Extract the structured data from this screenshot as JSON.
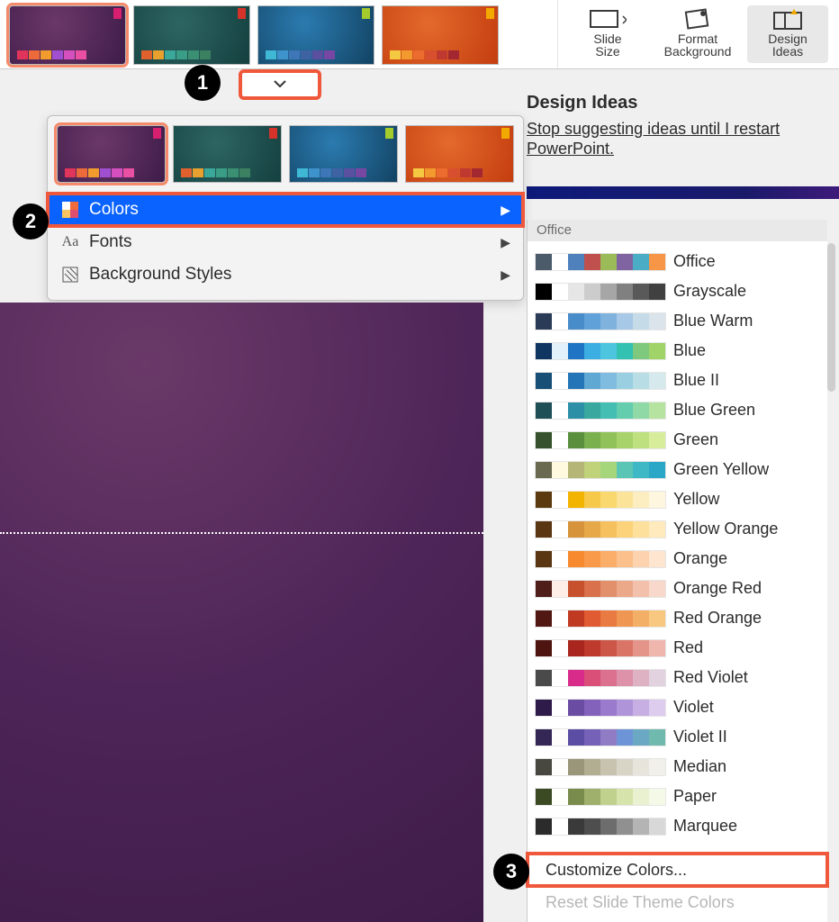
{
  "ribbon": {
    "slide_size": "Slide\nSize",
    "format_bg": "Format\nBackground",
    "design_ideas": "Design\nIdeas"
  },
  "pane": {
    "title": "Design Ideas",
    "link": "Stop suggesting ideas until I restart PowerPoint."
  },
  "menu": {
    "colors": "Colors",
    "fonts": "Fonts",
    "bg_styles": "Background Styles"
  },
  "schemes_header": "Office",
  "schemes": [
    {
      "name": "Office",
      "c": [
        "#4b5b69",
        "#ffffff",
        "#4f81bd",
        "#c0504d",
        "#9bbb59",
        "#8064a2",
        "#4bacc6",
        "#f79646"
      ]
    },
    {
      "name": "Grayscale",
      "c": [
        "#000000",
        "#ffffff",
        "#e6e6e6",
        "#cccccc",
        "#a6a6a6",
        "#808080",
        "#595959",
        "#404040"
      ]
    },
    {
      "name": "Blue Warm",
      "c": [
        "#2a3b57",
        "#ffffff",
        "#488cc9",
        "#5fa1d8",
        "#7fb3de",
        "#a7c8e6",
        "#c6dbe8",
        "#dbe4ea"
      ]
    },
    {
      "name": "Blue",
      "c": [
        "#0f3561",
        "#e3f1fb",
        "#1f75c4",
        "#3daee1",
        "#4ec5df",
        "#33c1b1",
        "#7fc97f",
        "#a0d468"
      ]
    },
    {
      "name": "Blue II",
      "c": [
        "#184f76",
        "#ffffff",
        "#2375b7",
        "#5fa8d3",
        "#7fbce0",
        "#99cfe1",
        "#b9dde5",
        "#d6e9ec"
      ]
    },
    {
      "name": "Blue Green",
      "c": [
        "#1e4f56",
        "#ffffff",
        "#2c8fa6",
        "#3ba8a0",
        "#44beb3",
        "#63cdae",
        "#8fd9a7",
        "#b7e3a0"
      ]
    },
    {
      "name": "Green",
      "c": [
        "#37512e",
        "#ffffff",
        "#5a8f3e",
        "#7bb04f",
        "#91c25a",
        "#a8d26a",
        "#bfe07e",
        "#d8ed9c"
      ]
    },
    {
      "name": "Green Yellow",
      "c": [
        "#6a6a50",
        "#fffadf",
        "#b5b578",
        "#c0d27a",
        "#a6d67c",
        "#5bc5b5",
        "#3eb8c4",
        "#2aa6c6"
      ]
    },
    {
      "name": "Yellow",
      "c": [
        "#5a3a0e",
        "#ffffff",
        "#f2b400",
        "#f6c94a",
        "#f9d86f",
        "#fbe49a",
        "#fceec1",
        "#fef6df"
      ]
    },
    {
      "name": "Yellow Orange",
      "c": [
        "#5a3612",
        "#ffffff",
        "#d7933b",
        "#e7a84a",
        "#f5c15e",
        "#fcd37a",
        "#fde09c",
        "#feeabd"
      ]
    },
    {
      "name": "Orange",
      "c": [
        "#5a3612",
        "#ffffff",
        "#f78a2f",
        "#f99a4a",
        "#fbae6a",
        "#fcc08c",
        "#fdd3af",
        "#fee5d0"
      ]
    },
    {
      "name": "Orange Red",
      "c": [
        "#4f1e19",
        "#fdeee7",
        "#c7502d",
        "#d9714c",
        "#e2906c",
        "#eca98a",
        "#f2c0ab",
        "#f7d8cb"
      ]
    },
    {
      "name": "Red Orange",
      "c": [
        "#501713",
        "#ffffff",
        "#c03a22",
        "#e05a32",
        "#e97a41",
        "#ef9652",
        "#f4af66",
        "#f8c881"
      ]
    },
    {
      "name": "Red",
      "c": [
        "#4e1410",
        "#ffffff",
        "#a8261e",
        "#be3a2d",
        "#cc5648",
        "#d97467",
        "#e49488",
        "#efb6ad"
      ]
    },
    {
      "name": "Red Violet",
      "c": [
        "#4a4a4a",
        "#ffffff",
        "#d92c8a",
        "#d94f78",
        "#db718f",
        "#dd92a9",
        "#dfb2c3",
        "#e2d1de"
      ]
    },
    {
      "name": "Violet",
      "c": [
        "#2e1b4a",
        "#ffffff",
        "#6a4da3",
        "#8262bb",
        "#9a7acd",
        "#b094da",
        "#c7afe4",
        "#ddccee"
      ]
    },
    {
      "name": "Violet II",
      "c": [
        "#342755",
        "#fffdfb",
        "#5a4da3",
        "#7561b7",
        "#8f7cc4",
        "#6c94d6",
        "#6ba8c3",
        "#6fb9ae"
      ]
    },
    {
      "name": "Median",
      "c": [
        "#484840",
        "#fffdfb",
        "#9a9679",
        "#b2ae92",
        "#c7c3ae",
        "#d8d5c7",
        "#e6e4db",
        "#f1f0ea"
      ]
    },
    {
      "name": "Paper",
      "c": [
        "#3c4a24",
        "#fefffa",
        "#7a8c4b",
        "#9eb06b",
        "#c0d18e",
        "#d6e3ab",
        "#e9f1d0",
        "#f4f9e8"
      ]
    },
    {
      "name": "Marquee",
      "c": [
        "#2b2b2b",
        "#ffffff",
        "#3a3a3a",
        "#4e4e4e",
        "#6d6d6d",
        "#909090",
        "#b4b4b4",
        "#d8d8d8"
      ]
    }
  ],
  "footer": {
    "customize": "Customize Colors...",
    "reset": "Reset Slide Theme Colors"
  },
  "annotations": {
    "1": "1",
    "2": "2",
    "3": "3"
  }
}
